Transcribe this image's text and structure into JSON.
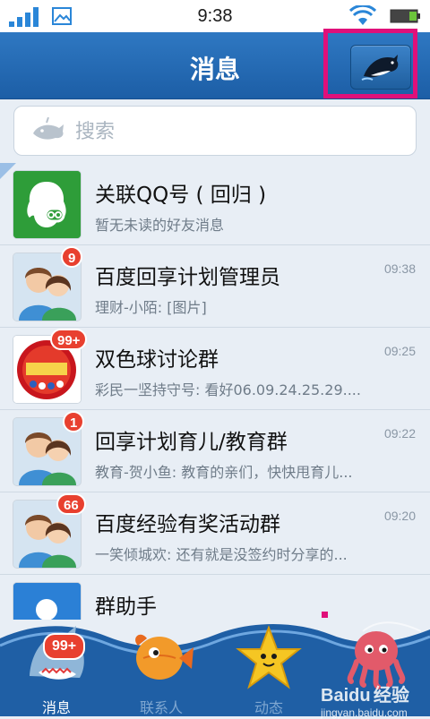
{
  "status_bar": {
    "time": "9:38"
  },
  "header": {
    "title": "消息"
  },
  "search": {
    "placeholder": "搜索"
  },
  "conversations": [
    {
      "name": "关联QQ号 ( 回归 )",
      "preview": "暂无未读的好友消息",
      "time": "",
      "badge": "",
      "avatar": "qq-link"
    },
    {
      "name": "百度回享计划管理员",
      "preview": "理财-小陌: [图片]",
      "time": "09:38",
      "badge": "9",
      "avatar": "couple"
    },
    {
      "name": "双色球讨论群",
      "preview": "彩民一坚持守号: 看好06.09.24.25.29....",
      "time": "09:25",
      "badge": "99+",
      "avatar": "lottery"
    },
    {
      "name": "回享计划育儿/教育群",
      "preview": "教育-贺小鱼: 教育的亲们，快快甩育儿...",
      "time": "09:22",
      "badge": "1",
      "avatar": "couple"
    },
    {
      "name": "百度经验有奖活动群",
      "preview": "一笑倾城欢: 还有就是没签约时分享的...",
      "time": "09:20",
      "badge": "66",
      "avatar": "couple"
    },
    {
      "name": "群助手",
      "preview": "",
      "time": "",
      "badge": "",
      "avatar": "helper"
    }
  ],
  "tabs": [
    {
      "label": "消息",
      "icon": "shark-icon",
      "active": true,
      "badge": "99+"
    },
    {
      "label": "联系人",
      "icon": "fish-icon",
      "active": false,
      "badge": ""
    },
    {
      "label": "动态",
      "icon": "starfish-icon",
      "active": false,
      "badge": ""
    },
    {
      "label": "",
      "icon": "octopus-icon",
      "active": false,
      "badge": ""
    }
  ],
  "watermark": {
    "brand": "Bai",
    "brand_mark": "du",
    "cn": "经验",
    "url": "jingyan.baidu.com"
  },
  "colors": {
    "header": "#2f78c2",
    "badge": "#e8402f",
    "highlight": "#e0107a",
    "tabbar": "#1f5fa5"
  }
}
